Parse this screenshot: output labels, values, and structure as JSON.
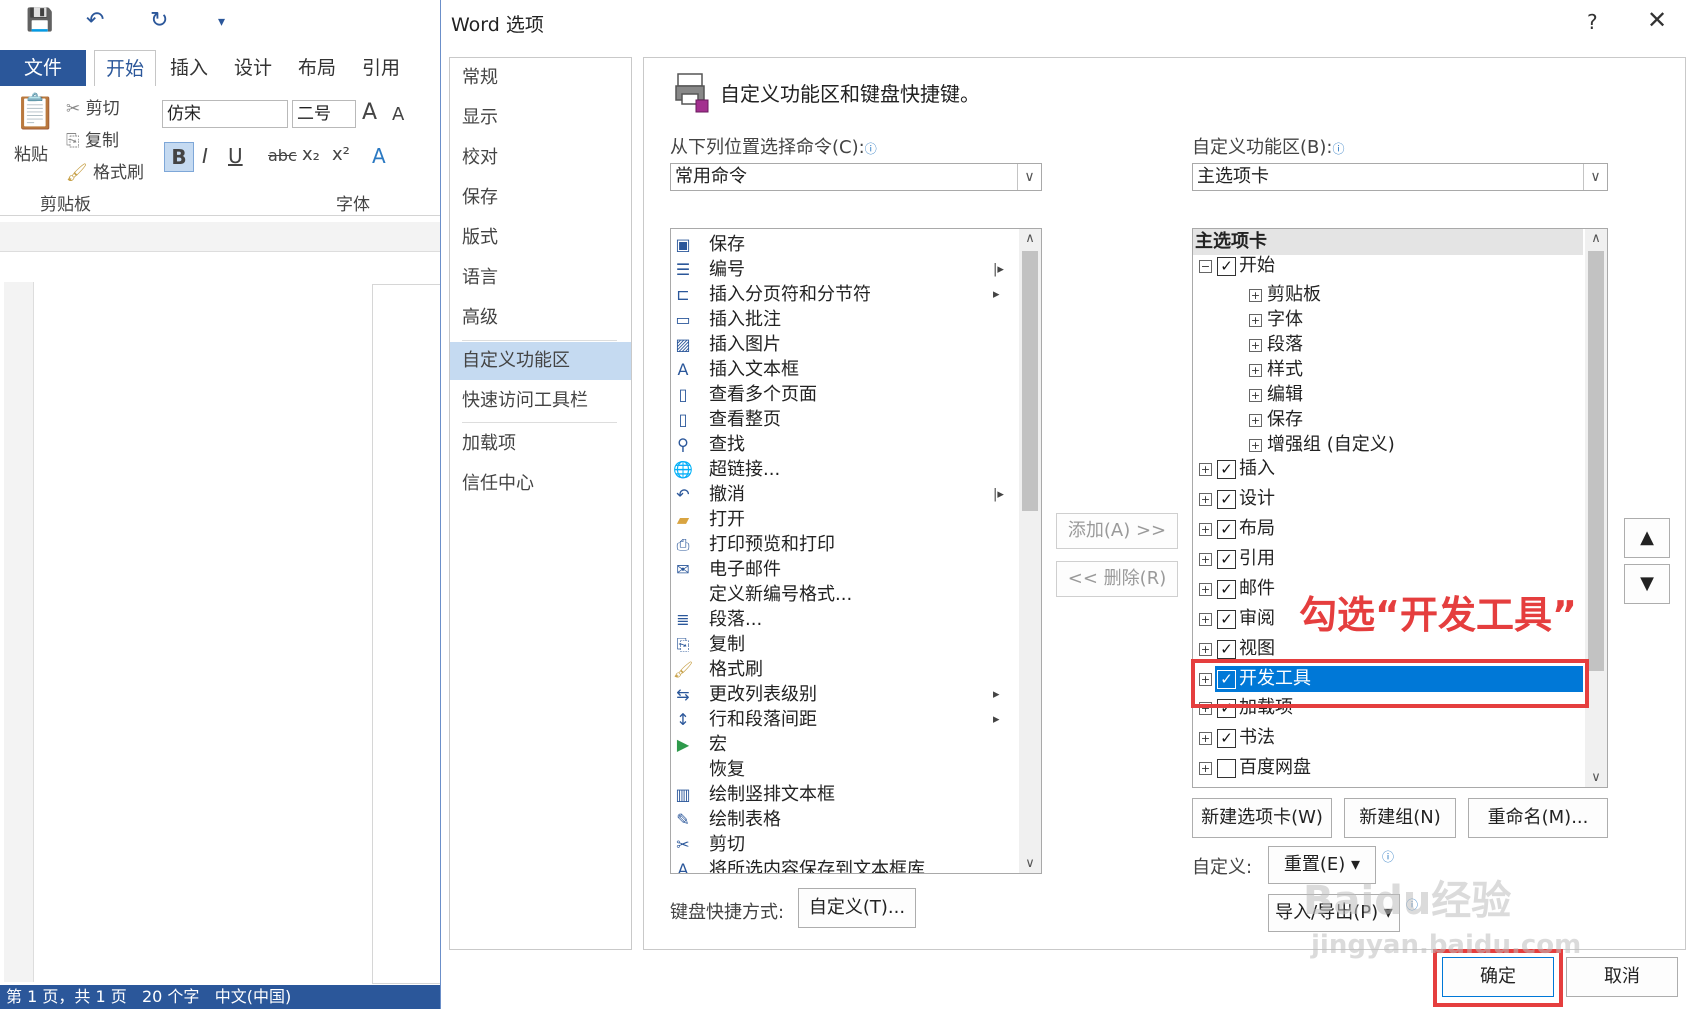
{
  "word": {
    "tabs": [
      "文件",
      "开始",
      "插入",
      "设计",
      "布局",
      "引用"
    ],
    "clipboard": {
      "paste": "粘贴",
      "cut": "剪切",
      "copy": "复制",
      "format_painter": "格式刷",
      "group": "剪贴板"
    },
    "font": {
      "name": "仿宋",
      "size": "二号",
      "group": "字体"
    },
    "status": {
      "page": "第 1 页，共 1 页",
      "words": "20 个字",
      "lang": "中文(中国)"
    }
  },
  "dialog": {
    "title": "Word 选项",
    "help": "?",
    "close": "✕",
    "nav": [
      "常规",
      "显示",
      "校对",
      "保存",
      "版式",
      "语言",
      "高级",
      "自定义功能区",
      "快速访问工具栏",
      "加载项",
      "信任中心"
    ],
    "heading": "自定义功能区和键盘快捷键。",
    "choose_from_label": "从下列位置选择命令(C):",
    "choose_from_value": "常用命令",
    "customize_label": "自定义功能区(B):",
    "customize_value": "主选项卡",
    "commands": [
      "保存",
      "编号",
      "插入分页符和分节符",
      "插入批注",
      "插入图片",
      "插入文本框",
      "查看多个页面",
      "查看整页",
      "查找",
      "超链接...",
      "撤消",
      "打开",
      "打印预览和打印",
      "电子邮件",
      "定义新编号格式...",
      "段落...",
      "复制",
      "格式刷",
      "更改列表级别",
      "行和段落间距",
      "宏",
      "恢复",
      "绘制竖排文本框",
      "绘制表格",
      "剪切",
      "将所选内容保存到文本框库"
    ],
    "tree_header": "主选项卡",
    "tree_root": "开始",
    "tree_groups": [
      "剪贴板",
      "字体",
      "段落",
      "样式",
      "编辑",
      "保存",
      "增强组 (自定义)"
    ],
    "tree_tabs": [
      "插入",
      "设计",
      "布局",
      "引用",
      "邮件",
      "审阅",
      "视图",
      "开发工具",
      "加载项",
      "书法",
      "百度网盘"
    ],
    "add_btn": "添加(A) >>",
    "remove_btn": "<< 删除(R)",
    "new_tab": "新建选项卡(W)",
    "new_group": "新建组(N)",
    "rename": "重命名(M)...",
    "custom_label": "自定义:",
    "reset": "重置(E) ▾",
    "import_export": "导入/导出(P) ▾",
    "kb_label": "键盘快捷方式:",
    "kb_btn": "自定义(T)...",
    "ok": "确定",
    "cancel": "取消",
    "annotation": "勾选“开发工具”",
    "watermark": "Baidu经验",
    "watermark_url": "jingyan.baidu.com"
  }
}
